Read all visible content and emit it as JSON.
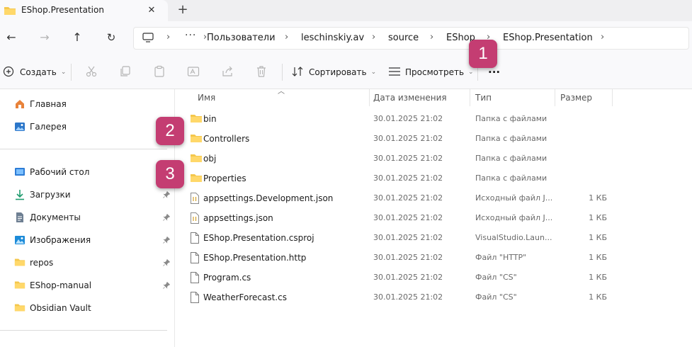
{
  "tab": {
    "title": "EShop.Presentation",
    "close_glyph": "✕",
    "new_glyph": "+"
  },
  "nav": {
    "back_glyph": "←",
    "forward_glyph": "→",
    "up_glyph": "↑",
    "refresh_glyph": "↻",
    "overflow_glyph": "···",
    "breadcrumb": [
      "Пользователи",
      "leschinskiy.av",
      "source",
      "EShop",
      "EShop.Presentation"
    ],
    "separator_glyph": "›"
  },
  "toolbar": {
    "create_label": "Создать",
    "sort_label": "Сортировать",
    "view_label": "Просмотреть",
    "more_glyph": "···",
    "caret_glyph": "⌄"
  },
  "sidebar": {
    "top_items": [
      {
        "label": "Главная",
        "icon": "home-icon"
      },
      {
        "label": "Галерея",
        "icon": "gallery-icon"
      }
    ],
    "quick_access": [
      {
        "label": "Рабочий стол",
        "icon": "desktop-icon",
        "pinned": false
      },
      {
        "label": "Загрузки",
        "icon": "download-icon",
        "pinned": true
      },
      {
        "label": "Документы",
        "icon": "documents-icon",
        "pinned": true
      },
      {
        "label": "Изображения",
        "icon": "pictures-icon",
        "pinned": true
      },
      {
        "label": "repos",
        "icon": "folder-icon",
        "pinned": true
      },
      {
        "label": "EShop-manual",
        "icon": "folder-icon",
        "pinned": true
      },
      {
        "label": "Obsidian Vault",
        "icon": "folder-icon",
        "pinned": false
      }
    ]
  },
  "columns": {
    "name": "Имя",
    "date": "Дата изменения",
    "type": "Тип",
    "size": "Размер"
  },
  "files": [
    {
      "name": "bin",
      "date": "30.01.2025 21:02",
      "type": "Папка с файлами",
      "size": "",
      "icon": "folder-icon"
    },
    {
      "name": "Controllers",
      "date": "30.01.2025 21:02",
      "type": "Папка с файлами",
      "size": "",
      "icon": "folder-icon"
    },
    {
      "name": "obj",
      "date": "30.01.2025 21:02",
      "type": "Папка с файлами",
      "size": "",
      "icon": "folder-icon"
    },
    {
      "name": "Properties",
      "date": "30.01.2025 21:02",
      "type": "Папка с файлами",
      "size": "",
      "icon": "folder-icon"
    },
    {
      "name": "appsettings.Development.json",
      "date": "30.01.2025 21:02",
      "type": "Исходный файл J...",
      "size": "1 КБ",
      "icon": "json-file-icon"
    },
    {
      "name": "appsettings.json",
      "date": "30.01.2025 21:02",
      "type": "Исходный файл J...",
      "size": "1 КБ",
      "icon": "json-file-icon"
    },
    {
      "name": "EShop.Presentation.csproj",
      "date": "30.01.2025 21:02",
      "type": "VisualStudio.Laun...",
      "size": "1 КБ",
      "icon": "file-icon"
    },
    {
      "name": "EShop.Presentation.http",
      "date": "30.01.2025 21:02",
      "type": "Файл \"HTTP\"",
      "size": "1 КБ",
      "icon": "file-icon"
    },
    {
      "name": "Program.cs",
      "date": "30.01.2025 21:02",
      "type": "Файл \"CS\"",
      "size": "1 КБ",
      "icon": "file-icon"
    },
    {
      "name": "WeatherForecast.cs",
      "date": "30.01.2025 21:02",
      "type": "Файл \"CS\"",
      "size": "1 КБ",
      "icon": "file-icon"
    }
  ],
  "badges": [
    "1",
    "2",
    "3"
  ],
  "colors": {
    "badge": "#c43d72",
    "folder": "#f4c74c",
    "accent": "#1e78d4"
  }
}
